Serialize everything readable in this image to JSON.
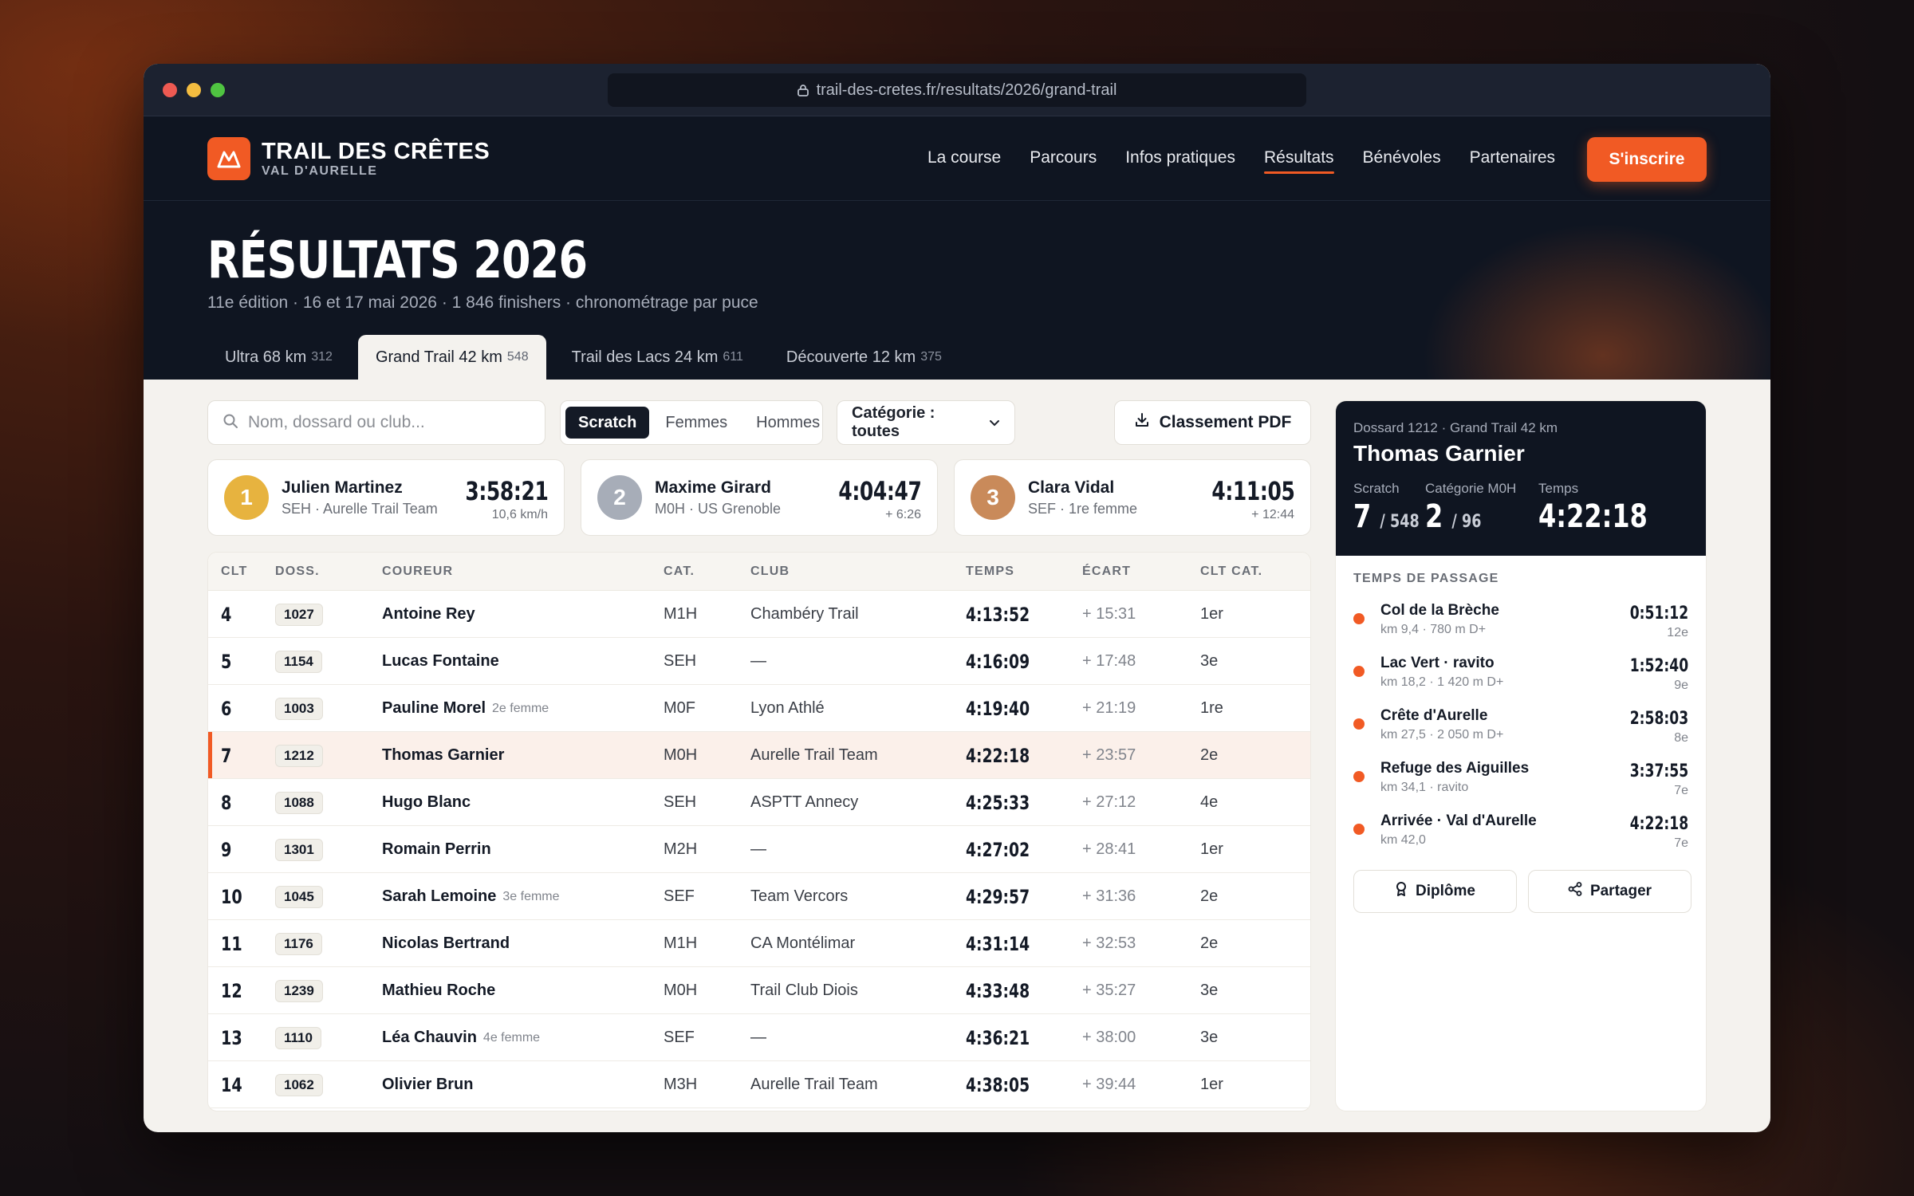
{
  "browser": {
    "url": "trail-des-cretes.fr/resultats/2026/grand-trail"
  },
  "brand": {
    "name": "TRAIL DES CRÊTES",
    "subtitle": "VAL D'AURELLE"
  },
  "nav": {
    "links": [
      "La course",
      "Parcours",
      "Infos pratiques",
      "Résultats",
      "Bénévoles",
      "Partenaires"
    ],
    "active": "Résultats",
    "cta": "S'inscrire"
  },
  "page": {
    "title": "RÉSULTATS 2026",
    "subtitle": "11e édition · 16 et 17 mai 2026 · 1 846 finishers · chronométrage par puce"
  },
  "race_tabs": [
    {
      "label": "Ultra 68 km",
      "count": "312",
      "active": false
    },
    {
      "label": "Grand Trail 42 km",
      "count": "548",
      "active": true
    },
    {
      "label": "Trail des Lacs 24 km",
      "count": "611",
      "active": false
    },
    {
      "label": "Découverte 12 km",
      "count": "375",
      "active": false
    }
  ],
  "filters": {
    "search_placeholder": "Nom, dossard ou club...",
    "segments": [
      "Scratch",
      "Femmes",
      "Hommes"
    ],
    "active_segment": "Scratch",
    "category": "Catégorie : toutes",
    "pdf": "Classement PDF"
  },
  "podium": [
    {
      "rank": "1",
      "name": "Julien Martinez",
      "meta": "SEH · Aurelle Trail Team",
      "time": "3:58:21",
      "sub": "10,6 km/h",
      "medal": "gold"
    },
    {
      "rank": "2",
      "name": "Maxime Girard",
      "meta": "M0H · US Grenoble",
      "time": "4:04:47",
      "sub": "+ 6:26",
      "medal": "silver"
    },
    {
      "rank": "3",
      "name": "Clara Vidal",
      "meta": "SEF · 1re femme",
      "time": "4:11:05",
      "sub": "+ 12:44",
      "medal": "bronze"
    }
  ],
  "table": {
    "headers": {
      "rank": "CLT",
      "bib": "DOSS.",
      "name": "COUREUR",
      "cat": "CAT.",
      "club": "CLUB",
      "time": "TEMPS",
      "gap": "ÉCART",
      "catrank": "CLT CAT."
    },
    "rows": [
      {
        "rank": "4",
        "bib": "1027",
        "name": "Antoine Rey",
        "note": "",
        "cat": "M1H",
        "club": "Chambéry Trail",
        "time": "4:13:52",
        "gap": "+ 15:31",
        "catrank": "1er"
      },
      {
        "rank": "5",
        "bib": "1154",
        "name": "Lucas Fontaine",
        "note": "",
        "cat": "SEH",
        "club": "—",
        "time": "4:16:09",
        "gap": "+ 17:48",
        "catrank": "3e"
      },
      {
        "rank": "6",
        "bib": "1003",
        "name": "Pauline Morel",
        "note": "2e femme",
        "cat": "M0F",
        "club": "Lyon Athlé",
        "time": "4:19:40",
        "gap": "+ 21:19",
        "catrank": "1re"
      },
      {
        "rank": "7",
        "bib": "1212",
        "name": "Thomas Garnier",
        "note": "",
        "cat": "M0H",
        "club": "Aurelle Trail Team",
        "time": "4:22:18",
        "gap": "+ 23:57",
        "catrank": "2e",
        "highlight": true
      },
      {
        "rank": "8",
        "bib": "1088",
        "name": "Hugo Blanc",
        "note": "",
        "cat": "SEH",
        "club": "ASPTT Annecy",
        "time": "4:25:33",
        "gap": "+ 27:12",
        "catrank": "4e"
      },
      {
        "rank": "9",
        "bib": "1301",
        "name": "Romain Perrin",
        "note": "",
        "cat": "M2H",
        "club": "—",
        "time": "4:27:02",
        "gap": "+ 28:41",
        "catrank": "1er"
      },
      {
        "rank": "10",
        "bib": "1045",
        "name": "Sarah Lemoine",
        "note": "3e femme",
        "cat": "SEF",
        "club": "Team Vercors",
        "time": "4:29:57",
        "gap": "+ 31:36",
        "catrank": "2e"
      },
      {
        "rank": "11",
        "bib": "1176",
        "name": "Nicolas Bertrand",
        "note": "",
        "cat": "M1H",
        "club": "CA Montélimar",
        "time": "4:31:14",
        "gap": "+ 32:53",
        "catrank": "2e"
      },
      {
        "rank": "12",
        "bib": "1239",
        "name": "Mathieu Roche",
        "note": "",
        "cat": "M0H",
        "club": "Trail Club Diois",
        "time": "4:33:48",
        "gap": "+ 35:27",
        "catrank": "3e"
      },
      {
        "rank": "13",
        "bib": "1110",
        "name": "Léa Chauvin",
        "note": "4e femme",
        "cat": "SEF",
        "club": "—",
        "time": "4:36:21",
        "gap": "+ 38:00",
        "catrank": "3e"
      },
      {
        "rank": "14",
        "bib": "1062",
        "name": "Olivier Brun",
        "note": "",
        "cat": "M3H",
        "club": "Aurelle Trail Team",
        "time": "4:38:05",
        "gap": "+ 39:44",
        "catrank": "1er"
      }
    ]
  },
  "panel": {
    "kicker": "Dossard 1212 · Grand Trail 42 km",
    "name": "Thomas Garnier",
    "stats": [
      {
        "label": "Scratch",
        "value": "7",
        "of": "/ 548"
      },
      {
        "label": "Catégorie M0H",
        "value": "2",
        "of": "/ 96"
      },
      {
        "label": "Temps",
        "value": "4:22:18",
        "of": ""
      }
    ],
    "splits_title": "TEMPS DE PASSAGE",
    "splits": [
      {
        "name": "Col de la Brèche",
        "meta": "km 9,4 · 780 m D+",
        "time": "0:51:12",
        "rank": "12e"
      },
      {
        "name": "Lac Vert · ravito",
        "meta": "km 18,2 · 1 420 m D+",
        "time": "1:52:40",
        "rank": "9e"
      },
      {
        "name": "Crête d'Aurelle",
        "meta": "km 27,5 · 2 050 m D+",
        "time": "2:58:03",
        "rank": "8e"
      },
      {
        "name": "Refuge des Aiguilles",
        "meta": "km 34,1 · ravito",
        "time": "3:37:55",
        "rank": "7e"
      },
      {
        "name": "Arrivée · Val d'Aurelle",
        "meta": "km 42,0",
        "time": "4:22:18",
        "rank": "7e"
      }
    ],
    "actions": [
      "Diplôme",
      "Partager"
    ]
  },
  "colors": {
    "accent": "#f15a24",
    "dark": "#0f1521",
    "paper": "#f4f2ee"
  }
}
